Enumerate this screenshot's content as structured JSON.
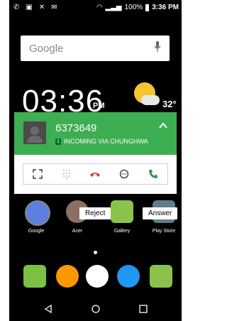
{
  "status_bar": {
    "battery_percent": "100%",
    "time": "3:36 PM",
    "left_icons": [
      "phone-icon",
      "image-icon",
      "wrench-icon",
      "mail-icon"
    ]
  },
  "search": {
    "placeholder": "Google"
  },
  "clock_widget": {
    "time": "03:36",
    "ampm": "PM",
    "temperature": "32°"
  },
  "call": {
    "number": "6373649",
    "sim_label": "1",
    "status": "INCOMING VIA CHUNGHWA",
    "header_color": "#3dae52"
  },
  "tooltips": {
    "reject": "Reject",
    "answer": "Answer"
  },
  "apps": [
    {
      "label": "Google",
      "color": "#4b6cd8"
    },
    {
      "label": "Acer",
      "color": "#ffcc00"
    },
    {
      "label": "Gallery",
      "color": "#8bc34a"
    },
    {
      "label": "Play Store",
      "color": "#607d8b"
    }
  ]
}
